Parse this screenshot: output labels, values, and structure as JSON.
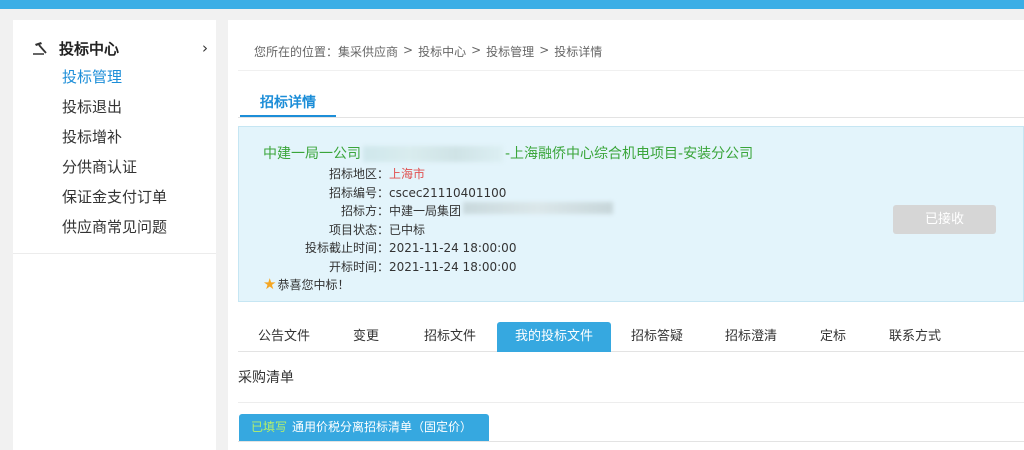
{
  "sidebar": {
    "title": "投标中心",
    "items": [
      {
        "label": "投标管理",
        "active": true
      },
      {
        "label": "投标退出"
      },
      {
        "label": "投标增补"
      },
      {
        "label": "分供商认证"
      },
      {
        "label": "保证金支付订单"
      },
      {
        "label": "供应商常见问题"
      }
    ]
  },
  "breadcrumb": {
    "prefix": "您所在的位置：",
    "items": [
      "集采供应商",
      "投标中心",
      "投标管理",
      "投标详情"
    ],
    "separator": ">"
  },
  "section_title": "招标详情",
  "tender": {
    "company_prefix": "中建一局一公司",
    "company_suffix": "-上海融侨中心综合机电项目-安装分公司",
    "fields": [
      {
        "label": "招标地区：",
        "value": "上海市"
      },
      {
        "label": "招标编号：",
        "value": "cscec21110401100"
      },
      {
        "label": "招标方：",
        "value": "中建一局集团"
      },
      {
        "label": "项目状态：",
        "value": "已中标"
      },
      {
        "label": "投标截止时间：",
        "value": "2021-11-24 18:00:00"
      },
      {
        "label": "开标时间：",
        "value": "2021-11-24 18:00:00"
      }
    ],
    "congrats": "恭喜您中标！",
    "accept_button": "已接收"
  },
  "tabs": [
    {
      "label": "公告文件"
    },
    {
      "label": "变更"
    },
    {
      "label": "招标文件"
    },
    {
      "label": "我的投标文件",
      "active": true
    },
    {
      "label": "招标答疑"
    },
    {
      "label": "招标澄清"
    },
    {
      "label": "定标"
    },
    {
      "label": "联系方式"
    }
  ],
  "purchase_list": {
    "title": "采购清单",
    "tab_status": "已填写",
    "tab_name": "通用价税分离招标清单（固定价）"
  },
  "colors": {
    "accent": "#36a8e0",
    "company_green": "#3aa53a",
    "info_bg": "#e3f4fb",
    "region_red": "#e05050"
  }
}
